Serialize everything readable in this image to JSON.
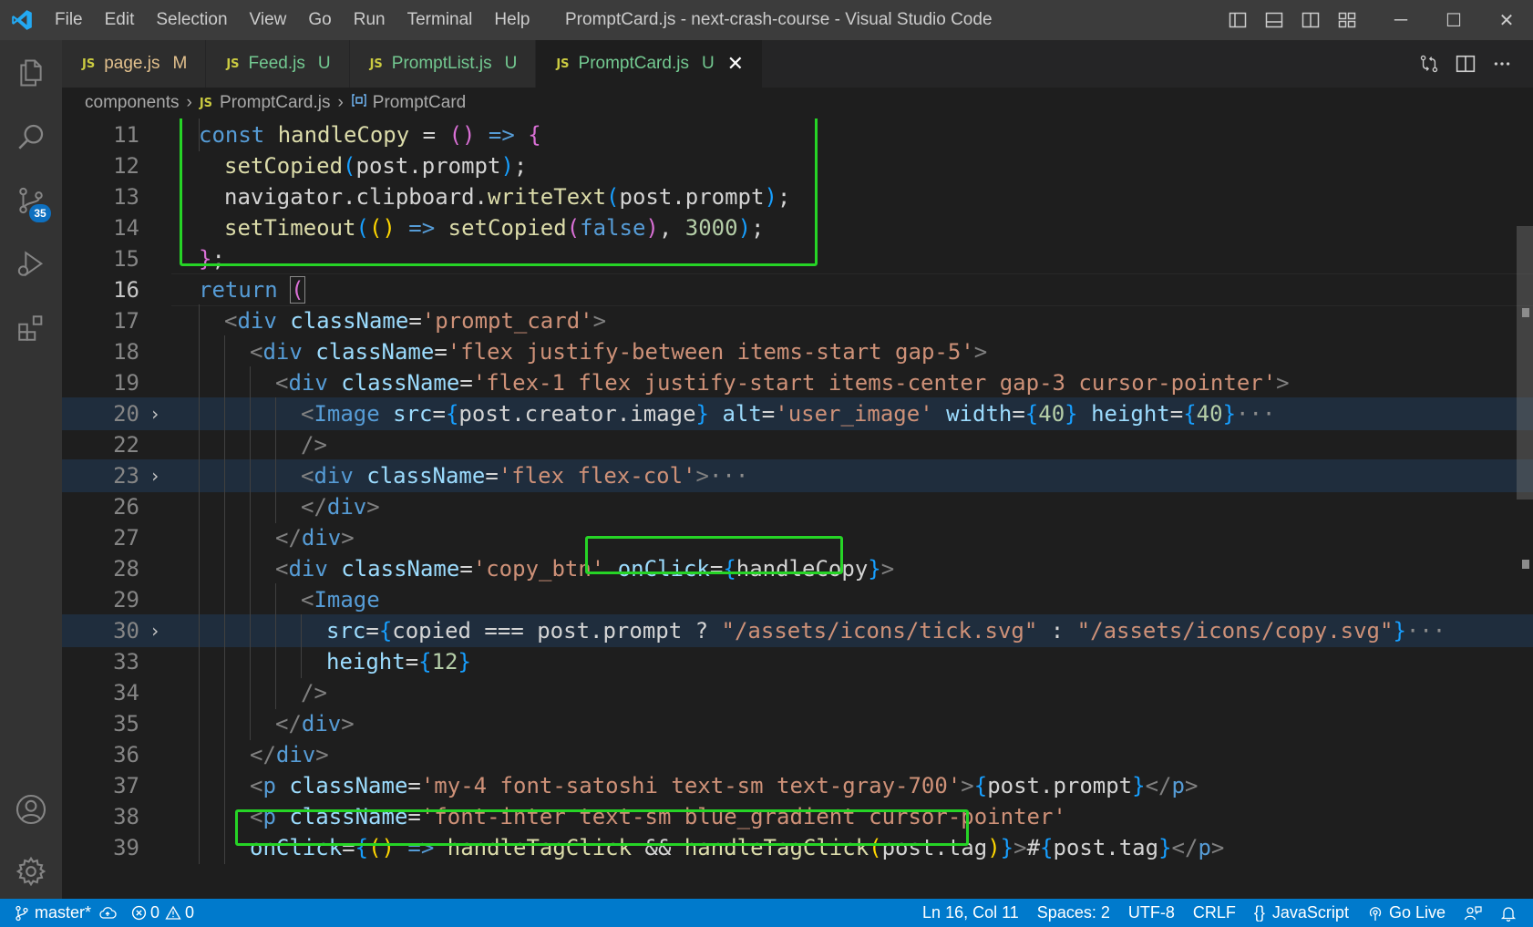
{
  "window": {
    "title": "PromptCard.js - next-crash-course - Visual Studio Code",
    "menu": [
      "File",
      "Edit",
      "Selection",
      "View",
      "Go",
      "Run",
      "Terminal",
      "Help"
    ],
    "controls": {
      "minimize": "─",
      "maximize": "☐",
      "close": "✕"
    }
  },
  "activity_bar": {
    "items": [
      "explorer-icon",
      "search-icon",
      "source-control-icon",
      "run-debug-icon",
      "extensions-icon"
    ],
    "source_control_badge": "35",
    "bottom": [
      "accounts-icon",
      "manage-gear-icon"
    ]
  },
  "tabs": [
    {
      "icon": "JS",
      "name": "page.js",
      "status": "M"
    },
    {
      "icon": "JS",
      "name": "Feed.js",
      "status": "U"
    },
    {
      "icon": "JS",
      "name": "PromptList.js",
      "status": "U"
    },
    {
      "icon": "JS",
      "name": "PromptCard.js",
      "status": "U",
      "close": "✕"
    }
  ],
  "breadcrumb": {
    "folder": "components",
    "file_icon": "JS",
    "file": "PromptCard.js",
    "symbol": "PromptCard",
    "separator": "›"
  },
  "gutter": {
    "line_numbers": [
      "11",
      "12",
      "13",
      "14",
      "15",
      "16",
      "17",
      "18",
      "19",
      "20",
      "22",
      "23",
      "26",
      "27",
      "28",
      "29",
      "30",
      "33",
      "34",
      "35",
      "36",
      "37",
      "38",
      "39"
    ],
    "folded_chevron": "›"
  },
  "code": {
    "l11": [
      "const",
      "handleCopy",
      " = ",
      "(",
      ")",
      " => ",
      "{"
    ],
    "l12": [
      "setCopied",
      "(",
      "post",
      ".",
      "prompt",
      ")",
      ";"
    ],
    "l13": [
      "navigator",
      ".",
      "clipboard",
      ".",
      "writeText",
      "(",
      "post",
      ".",
      "prompt",
      ")",
      ";"
    ],
    "l14": [
      "setTimeout",
      "(",
      "(",
      ")",
      " => ",
      "setCopied",
      "(",
      "false",
      ")",
      ", ",
      "3000",
      ")",
      ";"
    ],
    "l15": [
      "}",
      ";"
    ],
    "l16": [
      "return",
      " ",
      "("
    ],
    "l17": [
      "<",
      "div",
      " ",
      "className",
      "=",
      "'prompt_card'",
      ">"
    ],
    "l18": [
      "<",
      "div",
      " ",
      "className",
      "=",
      "'flex justify-between items-start gap-5'",
      ">"
    ],
    "l19": [
      "<",
      "div",
      " ",
      "className",
      "=",
      "'flex-1 flex justify-start items-center gap-3 cursor-pointer'",
      ">"
    ],
    "l20": [
      "<",
      "Image",
      " ",
      "src",
      "=",
      "{",
      "post",
      ".",
      "creator",
      ".",
      "image",
      "}",
      " ",
      "alt",
      "=",
      "'user_image'",
      " ",
      "width",
      "=",
      "{",
      "40",
      "}",
      " ",
      "height",
      "=",
      "{",
      "40",
      "}",
      "···"
    ],
    "l22": [
      "/>"
    ],
    "l23": [
      "<",
      "div",
      " ",
      "className",
      "=",
      "'flex flex-col'",
      ">",
      "···"
    ],
    "l26": [
      "</",
      "div",
      ">"
    ],
    "l27": [
      "</",
      "div",
      ">"
    ],
    "l28": [
      "<",
      "div",
      " ",
      "className",
      "=",
      "'copy_btn'",
      " ",
      "onClick",
      "=",
      "{",
      "handleCopy",
      "}",
      ">"
    ],
    "l29": [
      "<",
      "Image"
    ],
    "l30": [
      "src",
      "=",
      "{",
      "copied",
      " === ",
      "post",
      ".",
      "prompt",
      " ? ",
      "\"/assets/icons/tick.svg\"",
      " : ",
      "\"/assets/icons/copy.svg\"",
      "}",
      "···"
    ],
    "l33": [
      "height",
      "=",
      "{",
      "12",
      "}"
    ],
    "l34": [
      "/>"
    ],
    "l35": [
      "</",
      "div",
      ">"
    ],
    "l36": [
      "</",
      "div",
      ">"
    ],
    "l37": [
      "<",
      "p",
      " ",
      "className",
      "=",
      "'my-4 font-satoshi text-sm text-gray-700'",
      ">",
      "{",
      "post",
      ".",
      "prompt",
      "}",
      "</",
      "p",
      ">"
    ],
    "l38": [
      "<",
      "p",
      " ",
      "className",
      "=",
      "'font-inter text-sm blue_gradient cursor-pointer'"
    ],
    "l39": [
      "onClick",
      "=",
      "{",
      "(",
      ")",
      " => ",
      "handleTagClick",
      " && ",
      "handleTagClick",
      "(",
      "post",
      ".",
      "tag",
      ")",
      "}",
      ">",
      "#",
      "{",
      "post",
      ".",
      "tag",
      "}",
      "</",
      "p",
      ">"
    ]
  },
  "statusbar": {
    "branch": "master*",
    "errors": "0",
    "warnings": "0",
    "position": "Ln 16, Col 11",
    "spaces": "Spaces: 2",
    "encoding": "UTF-8",
    "eol": "CRLF",
    "language_icon": "{}",
    "language": "JavaScript",
    "go_live": "Go Live"
  },
  "colors": {
    "highlight_box": "#26d426",
    "statusbar": "#007acc",
    "keyword": "#569cd6",
    "string": "#ce9178",
    "function": "#dcdcaa"
  }
}
